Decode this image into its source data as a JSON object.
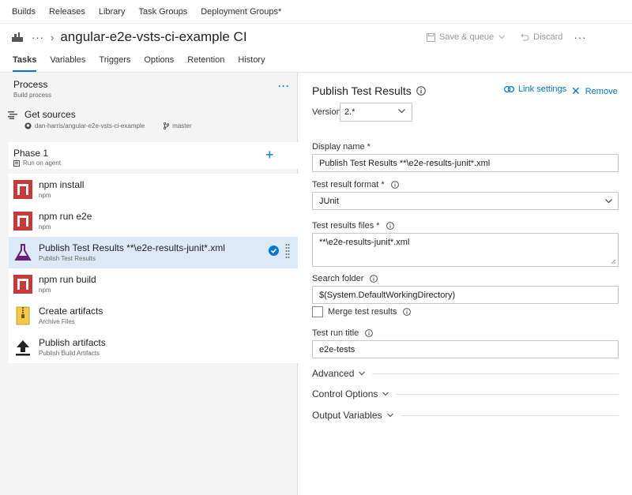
{
  "topnav": {
    "items": [
      "Builds",
      "Releases",
      "Library",
      "Task Groups",
      "Deployment Groups*"
    ]
  },
  "titlebar": {
    "ellipsis": "···",
    "chevron": "›",
    "title": "angular-e2e-vsts-ci-example CI",
    "save_queue": "Save & queue",
    "discard": "Discard",
    "more": "···"
  },
  "tabs": [
    "Tasks",
    "Variables",
    "Triggers",
    "Options",
    "Retention",
    "History"
  ],
  "left": {
    "process_title": "Process",
    "process_sub": "Build process",
    "process_more": "···",
    "get_sources": "Get sources",
    "repo": "dan-harris/angular-e2e-vsts-ci-example",
    "branch": "master",
    "phase_title": "Phase 1",
    "phase_sub": "Run on agent",
    "phase_add": "+",
    "tasks": [
      {
        "name": "npm install",
        "sub": "npm"
      },
      {
        "name": "npm run e2e",
        "sub": "npm"
      },
      {
        "name": "Publish Test Results **\\e2e-results-junit*.xml",
        "sub": "Publish Test Results"
      },
      {
        "name": "npm run build",
        "sub": "npm"
      },
      {
        "name": "Create artifacts",
        "sub": "Archive Files"
      },
      {
        "name": "Publish artifacts",
        "sub": "Publish Build Artifacts"
      }
    ]
  },
  "right": {
    "title": "Publish Test Results",
    "link_settings": "Link settings",
    "remove": "Remove",
    "version_label": "Version",
    "version_value": "2.*",
    "display_name_label": "Display name",
    "display_name_value": "Publish Test Results **\\e2e-results-junit*.xml",
    "format_label": "Test result format",
    "format_value": "JUnit",
    "files_label": "Test results files",
    "files_value": "**\\e2e-results-junit*.xml",
    "search_folder_label": "Search folder",
    "search_folder_value": "$(System.DefaultWorkingDirectory)",
    "merge_label": "Merge test results",
    "run_title_label": "Test run title",
    "run_title_value": "e2e-tests",
    "required_mark": "*",
    "sections": [
      "Advanced",
      "Control Options",
      "Output Variables"
    ]
  },
  "colors": {
    "accent": "#0078d4",
    "npm_red": "#cb3837",
    "selected_row": "#dceaf7",
    "left_bg": "#f4f4f4"
  },
  "icons": {
    "build": "build-pipeline-icon",
    "get_sources": "source-icon",
    "github": "github-icon",
    "branch": "branch-icon",
    "agent": "agent-icon",
    "npm": "npm-icon",
    "test": "flask-icon",
    "archive": "zip-icon",
    "publish": "upload-icon",
    "check": "check-circle-icon",
    "info": "info-icon",
    "link": "link-icon"
  }
}
